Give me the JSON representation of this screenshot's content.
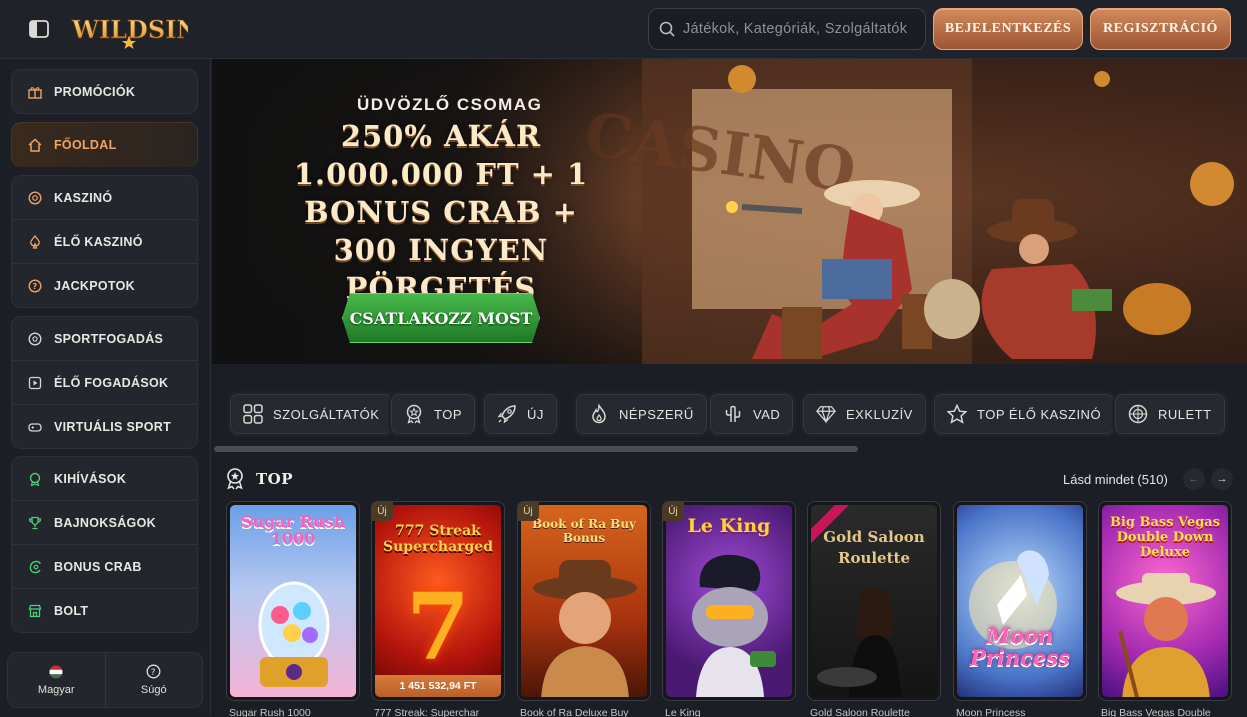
{
  "header": {
    "logo_text": "WILDSINO",
    "search_placeholder": "Játékok, Kategóriák, Szolgáltatók",
    "login_label": "BEJELENTKEZÉS",
    "register_label": "REGISZTRÁCIÓ"
  },
  "sidebar": {
    "promo": {
      "label": "PROMÓCIÓK",
      "icon": "gift-icon"
    },
    "home": {
      "label": "FŐOLDAL",
      "icon": "home-icon"
    },
    "casino": [
      {
        "label": "KASZINÓ",
        "icon": "poker-chip-icon"
      },
      {
        "label": "ÉLŐ KASZINÓ",
        "icon": "spade-icon"
      },
      {
        "label": "JACKPOTOK",
        "icon": "jackpot-icon"
      }
    ],
    "sport": [
      {
        "label": "SPORTFOGADÁS",
        "icon": "soccer-ball-icon"
      },
      {
        "label": "ÉLŐ FOGADÁSOK",
        "icon": "live-play-icon"
      },
      {
        "label": "VIRTUÁLIS SPORT",
        "icon": "gamepad-icon"
      }
    ],
    "extra": [
      {
        "label": "KIHÍVÁSOK",
        "icon": "medal-icon"
      },
      {
        "label": "BAJNOKSÁGOK",
        "icon": "trophy-icon"
      },
      {
        "label": "BONUS CRAB",
        "icon": "crab-icon"
      },
      {
        "label": "BOLT",
        "icon": "shop-icon"
      }
    ],
    "language_label": "Magyar",
    "help_label": "Súgó"
  },
  "banner": {
    "subtitle": "ÜDVÖZLŐ CSOMAG",
    "title": "250% AKÁR 1.000.000 FT + 1 BONUS CRAB + 300 INGYEN PÖRGETÉS",
    "cta_label": "CSATLAKOZZ MOST"
  },
  "categories": [
    {
      "label": "SZOLGÁLTATÓK",
      "icon": "grid-icon"
    },
    {
      "label": "TOP",
      "icon": "award-icon"
    },
    {
      "label": "ÚJ",
      "icon": "rocket-icon"
    },
    {
      "label": "NÉPSZERŰ",
      "icon": "flame-icon"
    },
    {
      "label": "VAD",
      "icon": "cactus-icon"
    },
    {
      "label": "EXKLUZÍV",
      "icon": "diamond-icon"
    },
    {
      "label": "TOP ÉLŐ KASZINÓ",
      "icon": "star-icon"
    },
    {
      "label": "RULETT",
      "icon": "roulette-icon"
    }
  ],
  "section": {
    "title": "TOP",
    "see_all_label": "Lásd mindet (510)"
  },
  "games": [
    {
      "name": "Sugar Rush 1000",
      "art_title": "Sugar Rush 1000",
      "badge": "",
      "jackpot": ""
    },
    {
      "name": "777 Streak: Superchar",
      "art_title": "777 Streak Supercharged",
      "badge": "Új",
      "jackpot": "1 451 532,94 FT"
    },
    {
      "name": "Book of Ra Deluxe Buy",
      "art_title": "Book of Ra Buy Bonus",
      "badge": "Új",
      "jackpot": ""
    },
    {
      "name": "Le King",
      "art_title": "Le King",
      "badge": "Új",
      "jackpot": ""
    },
    {
      "name": "Gold Saloon Roulette",
      "art_title": "Gold Saloon Roulette",
      "badge": "",
      "jackpot": ""
    },
    {
      "name": "Moon Princess",
      "art_title": "Moon Princess",
      "badge": "",
      "jackpot": ""
    },
    {
      "name": "Big Bass Vegas Double",
      "art_title": "Big Bass Vegas Double Down Deluxe",
      "badge": "",
      "jackpot": ""
    }
  ],
  "colors": {
    "accent_bronze": "#c07848",
    "active_nav": "#f0a365",
    "cta_green": "#2f9a35",
    "background": "#1b1e24"
  }
}
